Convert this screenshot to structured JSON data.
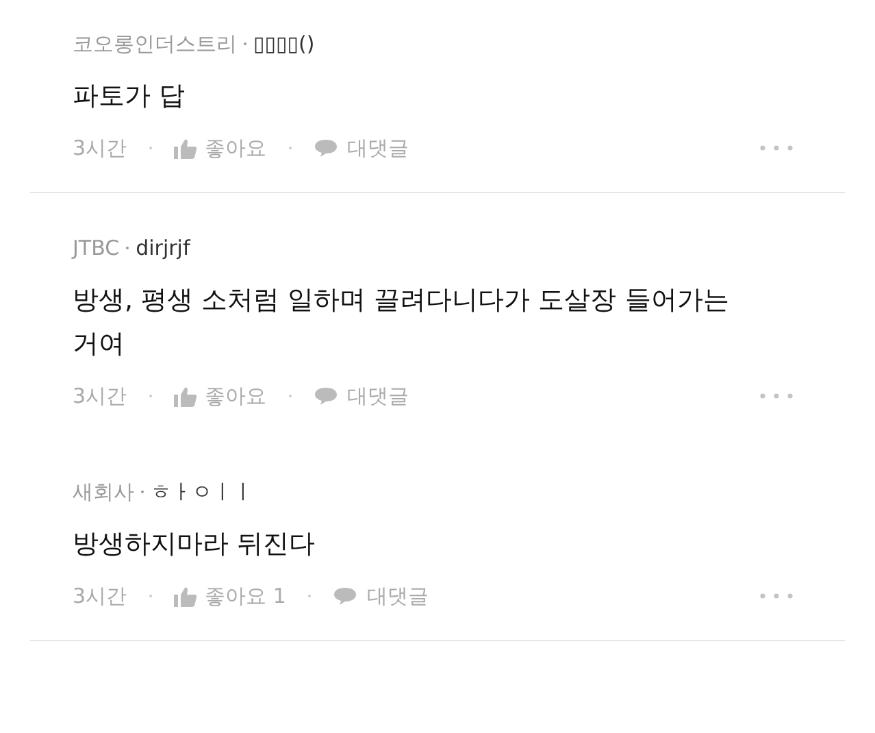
{
  "comments": [
    {
      "source": "코오롱인더스트리",
      "author": "▯▯▯▯()",
      "body": "파토가 답",
      "time": "3시간",
      "like": "좋아요",
      "reply": "대댓글",
      "divider_below": true
    },
    {
      "source": "JTBC",
      "author": "dirjrjf",
      "body": "방생, 평생 소처럼 일하며 끌려다니다가 도살장 들어가는 거여",
      "time": "3시간",
      "like": "좋아요",
      "reply": "대댓글",
      "divider_below": false
    },
    {
      "source": "새회사",
      "author": "ㅎㅏㅇㅣㅣ",
      "body": "방생하지마라 뒤진다",
      "time": "3시간",
      "like": "좋아요 1",
      "reply": "대댓글",
      "divider_below": true
    }
  ]
}
